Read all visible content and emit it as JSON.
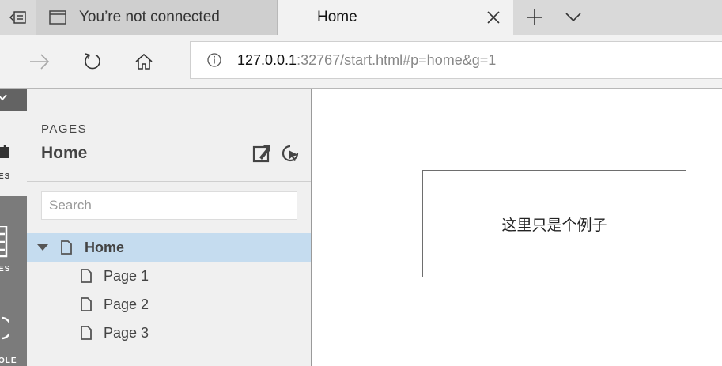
{
  "browser": {
    "tabs": [
      {
        "title": "You’re not connected",
        "icon": "window-icon",
        "active": false
      },
      {
        "title": "Home",
        "active": true
      }
    ],
    "address": {
      "host": "127.0.0.1",
      "rest": ":32767/start.html#p=home&g=1"
    }
  },
  "rail": {
    "labels": [
      "ES",
      "ES",
      "OLE"
    ]
  },
  "panel": {
    "heading": "PAGES",
    "title": "Home",
    "search_placeholder": "Search",
    "pages": [
      {
        "label": "Home",
        "selected": true,
        "expanded": true,
        "level": 0
      },
      {
        "label": "Page 1",
        "selected": false,
        "level": 1
      },
      {
        "label": "Page 2",
        "selected": false,
        "level": 1
      },
      {
        "label": "Page 3",
        "selected": false,
        "level": 1
      }
    ]
  },
  "canvas": {
    "example_text": "这里只是个例子"
  },
  "colors": {
    "selected_row": "#c5dcef",
    "rail": "#7b7b7b",
    "panel": "#f0f0f0"
  }
}
